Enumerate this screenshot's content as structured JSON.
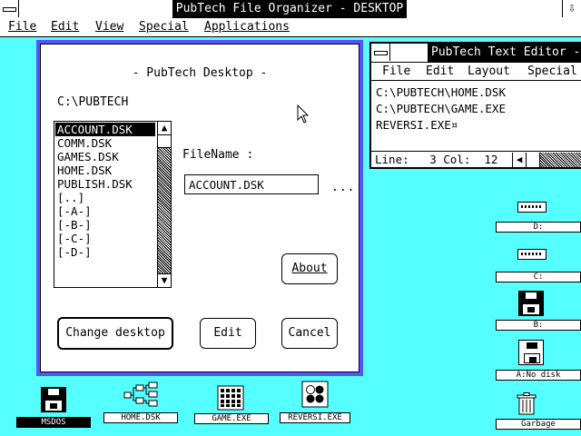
{
  "app": {
    "title": "PubTech File Organizer - DESKTOP",
    "min_glyph": "⇩"
  },
  "menu": {
    "items": [
      "File",
      "Edit",
      "View",
      "Special",
      "Applications"
    ]
  },
  "dialog": {
    "title": "- PubTech Desktop -",
    "path": "C:\\PUBTECH",
    "files": [
      "ACCOUNT.DSK",
      "COMM.DSK",
      "GAMES.DSK",
      "HOME.DSK",
      "PUBLISH.DSK",
      "[..]",
      "[-A-]",
      "[-B-]",
      "[-C-]",
      "[-D-]"
    ],
    "selected_index": 0,
    "filename_label": "FileName :",
    "filename_value": "ACCOUNT.DSK",
    "browse_label": "...",
    "buttons": {
      "about": "About",
      "change_desktop": "Change desktop",
      "edit": "Edit",
      "cancel": "Cancel"
    }
  },
  "editor": {
    "title": "PubTech Text Editor -",
    "menu": [
      "File",
      "Edit",
      "Layout",
      "Special"
    ],
    "lines": [
      "C:\\PUBTECH\\HOME.DSK",
      "C:\\PUBTECH\\GAME.EXE",
      "REVERSI.EXE¤"
    ],
    "status": "Line:   3 Col:  12"
  },
  "desktop_icons": {
    "msdos": "MSDOS",
    "home": "HOME.DSK",
    "game": "GAME.EXE",
    "reversi": "REVERSI.EXE",
    "drive_d": "D:",
    "drive_c": "C:",
    "drive_b": "B:",
    "drive_a": "A:No disk",
    "garbage": "Garbage"
  }
}
